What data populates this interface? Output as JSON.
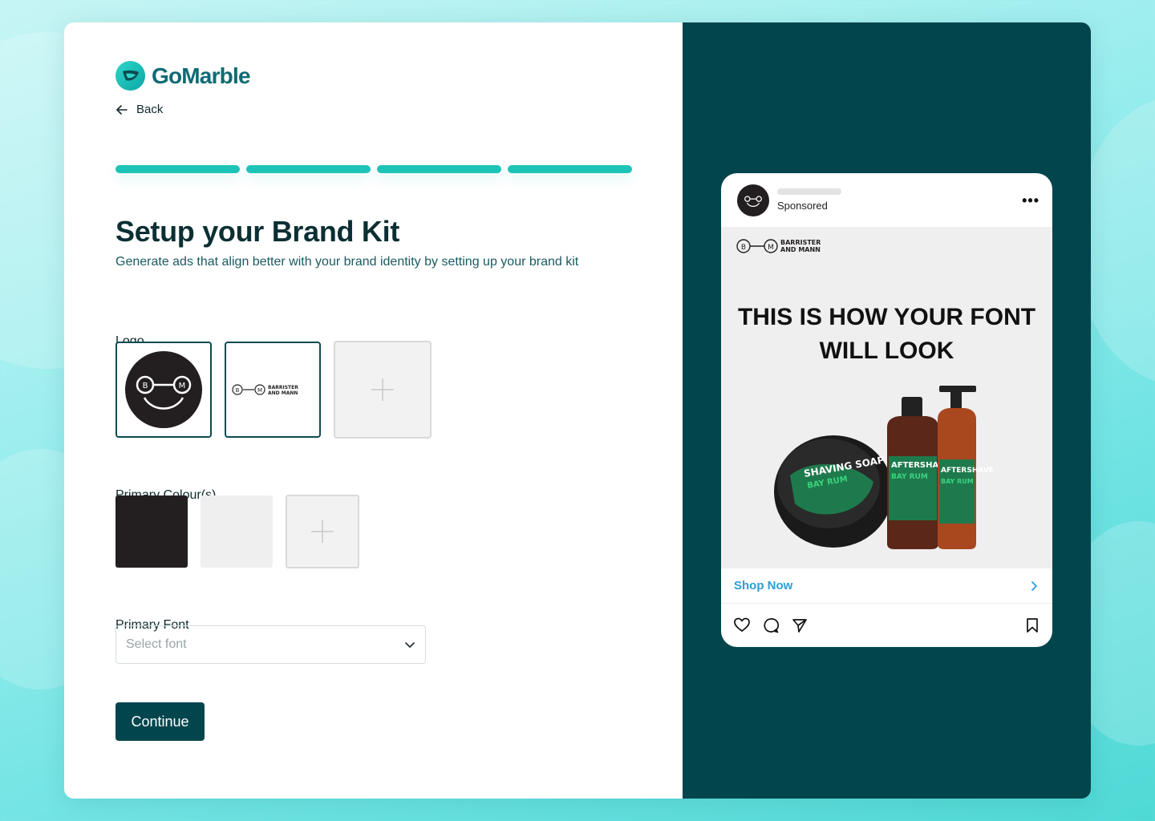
{
  "brand": {
    "name": "GoMarble"
  },
  "nav": {
    "back_label": "Back"
  },
  "progress": {
    "steps_total": 4,
    "steps_completed": 4
  },
  "page": {
    "title": "Setup your Brand Kit",
    "subtitle": "Generate ads that align better with your brand identity by setting up your brand kit"
  },
  "logo_section": {
    "label": "Logo",
    "logos": [
      {
        "name": "circle-smiley-logo"
      },
      {
        "name": "wordmark-logo",
        "text": "BARRISTER AND MANN"
      }
    ]
  },
  "colors_section": {
    "label": "Primary Colour(s)",
    "colors": [
      "#231f20",
      "#efefef"
    ]
  },
  "font_section": {
    "label": "Primary Font",
    "placeholder": "Select font"
  },
  "actions": {
    "continue_label": "Continue"
  },
  "preview": {
    "sponsored_label": "Sponsored",
    "brand_text": "BARRISTER AND MANN",
    "headline_line1": "THIS IS HOW YOUR FONT",
    "headline_line2": "WILL LOOK",
    "cta_label": "Shop Now",
    "product_labels": [
      "SHAVING SOAP",
      "BAY RUM",
      "AFTERSHAVE",
      "BAY RUM",
      "AFTERSHAVE",
      "BAY RUM"
    ]
  },
  "theme": {
    "accent": "#1ec3b8",
    "dark": "#03454d",
    "link": "#2b9ed4"
  }
}
